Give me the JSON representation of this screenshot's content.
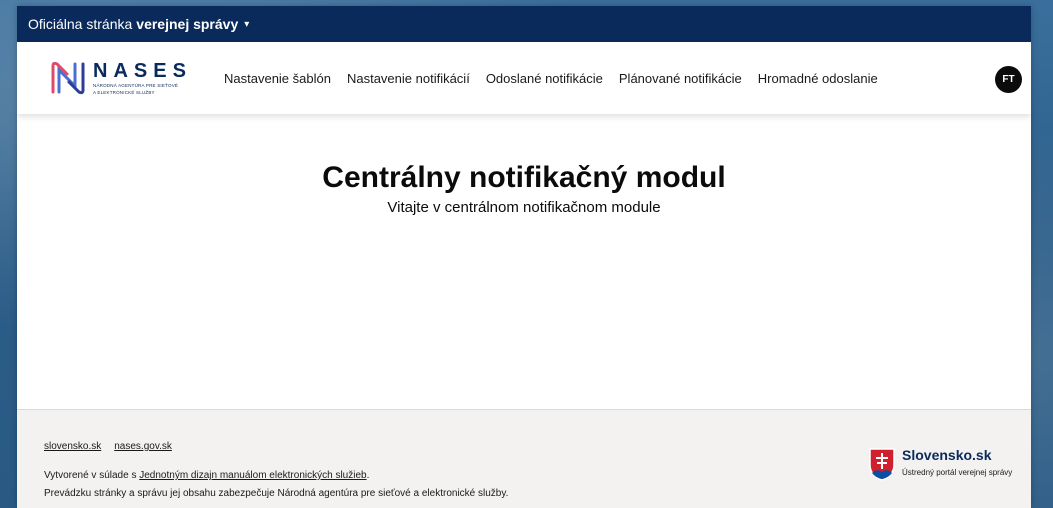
{
  "gov_bar": {
    "prefix": "Oficiálna stránka",
    "bold": "verejnej správy",
    "caret": "▾"
  },
  "logo": {
    "name": "NASES",
    "subtitle_line1": "Národná agentúra pre sieťové",
    "subtitle_line2": "a elektronické služby"
  },
  "nav": {
    "items": [
      {
        "label": "Nastavenie šablón"
      },
      {
        "label": "Nastavenie notifikácií"
      },
      {
        "label": "Odoslané notifikácie"
      },
      {
        "label": "Plánované notifikácie"
      },
      {
        "label": "Hromadné odoslanie"
      }
    ]
  },
  "user": {
    "initials": "FT"
  },
  "main": {
    "title": "Centrálny notifikačný modul",
    "subtitle": "Vitajte v centrálnom notifikačnom module"
  },
  "footer": {
    "links": [
      {
        "label": "slovensko.sk"
      },
      {
        "label": "nases.gov.sk"
      }
    ],
    "line1_prefix": "Vytvorené v súlade s ",
    "line1_link": "Jednotným dizajn manuálom elektronických služieb",
    "line1_suffix": ".",
    "line2": "Prevádzku stránky a správu jej obsahu zabezpečuje Národná agentúra pre sieťové a elektronické služby.",
    "brand_name": "Slovensko.sk",
    "brand_sub": "Ústredný portál verejnej správy"
  },
  "colors": {
    "gov_bar": "#0b2a5c",
    "avatar": "#0b0b0b",
    "footer_bg": "#f3f2f1",
    "shield_red": "#d0202e",
    "shield_blue": "#0b4ea2"
  }
}
